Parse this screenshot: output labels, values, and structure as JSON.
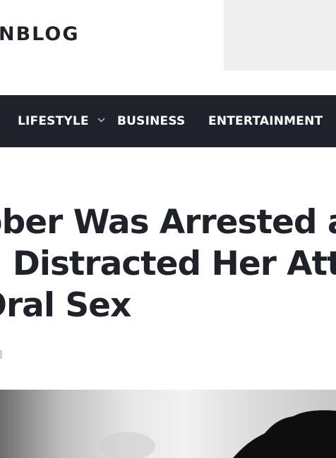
{
  "header": {
    "logo_text": "NBLOG"
  },
  "nav": {
    "items": [
      {
        "label": "LIFESTYLE",
        "has_dropdown": true
      },
      {
        "label": "BUSINESS",
        "has_dropdown": false
      },
      {
        "label": "ENTERTAINMENT",
        "has_dropdown": false
      }
    ]
  },
  "article": {
    "title_lines": [
      "bber Was Arrested a",
      "n Distracted Her Atte",
      "Oral Sex"
    ]
  },
  "colors": {
    "nav_background": "#1e232b",
    "text": "#1f2329",
    "ad_placeholder": "#efefef"
  },
  "icons": {
    "dropdown": "chevron-down-icon"
  }
}
